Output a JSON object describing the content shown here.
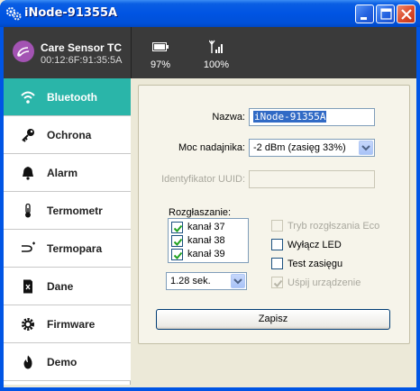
{
  "window": {
    "title": "iNode-91355A",
    "icon": "gear-cluster-icon"
  },
  "header": {
    "device_name": "Care Sensor TC",
    "device_mac": "00:12:6F:91:35:5A",
    "battery": "97%",
    "signal": "100%"
  },
  "sidebar": {
    "items": [
      {
        "label": "Bluetooth",
        "icon": "wifi-icon",
        "active": true
      },
      {
        "label": "Ochrona",
        "icon": "key-icon",
        "active": false
      },
      {
        "label": "Alarm",
        "icon": "bell-icon",
        "active": false
      },
      {
        "label": "Termometr",
        "icon": "thermometer-icon",
        "active": false
      },
      {
        "label": "Termopara",
        "icon": "thermocouple-icon",
        "active": false
      },
      {
        "label": "Dane",
        "icon": "data-file-icon",
        "active": false
      },
      {
        "label": "Firmware",
        "icon": "gear-icon",
        "active": false
      },
      {
        "label": "Demo",
        "icon": "fire-icon",
        "active": false
      }
    ]
  },
  "form": {
    "name_label": "Nazwa:",
    "name_value": "iNode-91355A",
    "power_label": "Moc nadajnika:",
    "power_value": "-2 dBm  (zasięg 33%)",
    "uuid_label": "Identyfikator UUID:",
    "uuid_value": "",
    "broadcast_label": "Rozgłaszanie:",
    "channels": [
      {
        "label": "kanał 37",
        "checked": true
      },
      {
        "label": "kanał 38",
        "checked": true
      },
      {
        "label": "kanał 39",
        "checked": true
      }
    ],
    "interval_value": "1.28 sek.",
    "options": [
      {
        "label": "Tryb rozgłszania Eco",
        "checked": false,
        "enabled": false
      },
      {
        "label": "Wyłącz LED",
        "checked": false,
        "enabled": true
      },
      {
        "label": "Test zasięgu",
        "checked": false,
        "enabled": true
      },
      {
        "label": "Uśpij urządzenie",
        "checked": true,
        "enabled": false
      }
    ],
    "save_label": "Zapisz"
  },
  "colors": {
    "accent": "#2ab5a9",
    "header_bg": "#3a3a3a",
    "titlebar": "#0054e3"
  }
}
